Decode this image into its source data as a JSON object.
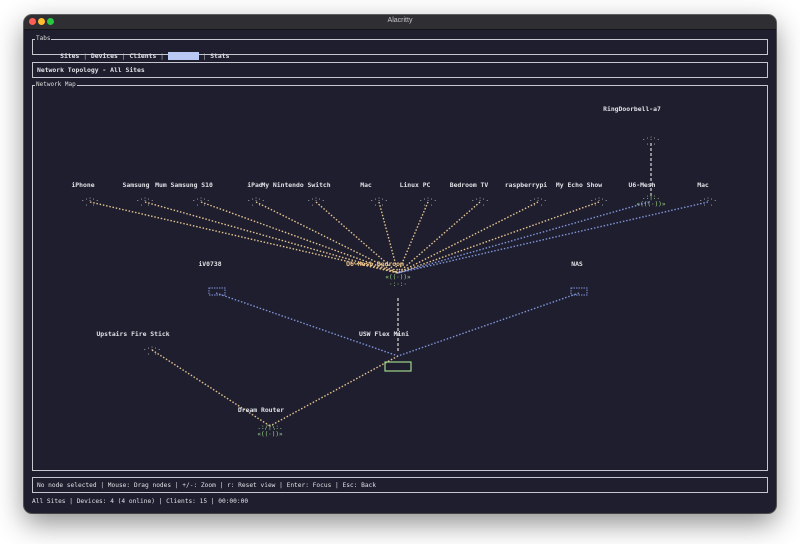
{
  "window": {
    "title": "Alacritty"
  },
  "tabs": {
    "title": "Tabs",
    "items": [
      "Sites",
      "Devices",
      "Clients",
      "Topology",
      "Stats"
    ],
    "active_index": 3
  },
  "topology": {
    "title": "Network Topology - All Sites"
  },
  "network_map": {
    "title": "Network Map",
    "nodes": {
      "iphone": "iPhone",
      "samsung": "Samsung",
      "mum_samsung": "Mum Samsung S10",
      "ipad": "iPad",
      "nintendo": "My Nintendo Switch",
      "mac1": "Mac",
      "linux": "Linux PC",
      "bedroom_tv": "Bedroom TV",
      "raspberrypi": "raspberrypi",
      "echo": "My Echo Show",
      "u6mesh": "U6-Mesh",
      "mac2": "Mac",
      "ringdoorbell": "RingDoorbell-a7",
      "u6mesh_bedroom": "U6-Mesh Bedroom",
      "iv0738": "iV0738",
      "nas": "NAS",
      "usw_flex_mini": "USW Flex Mini",
      "upstairs_fire": "Upstairs Fire Stick",
      "dream_router": "Dream Router"
    },
    "colors": {
      "client_link": "#e3c38f",
      "wired_link": "#7f93d6",
      "uplink": "#d8d8d8",
      "device_icon": "#9fd58a",
      "client_icon": "#d0d0d0",
      "label": "#e0e0e6",
      "highlight_label": "#f3c98b"
    }
  },
  "help": {
    "text": "No node selected | Mouse: Drag nodes | +/-: Zoom | r: Reset view | Enter: Focus | Esc: Back"
  },
  "status": {
    "text": "All Sites | Devices: 4 (4 online) | Clients: 15 | 00:00:00"
  }
}
